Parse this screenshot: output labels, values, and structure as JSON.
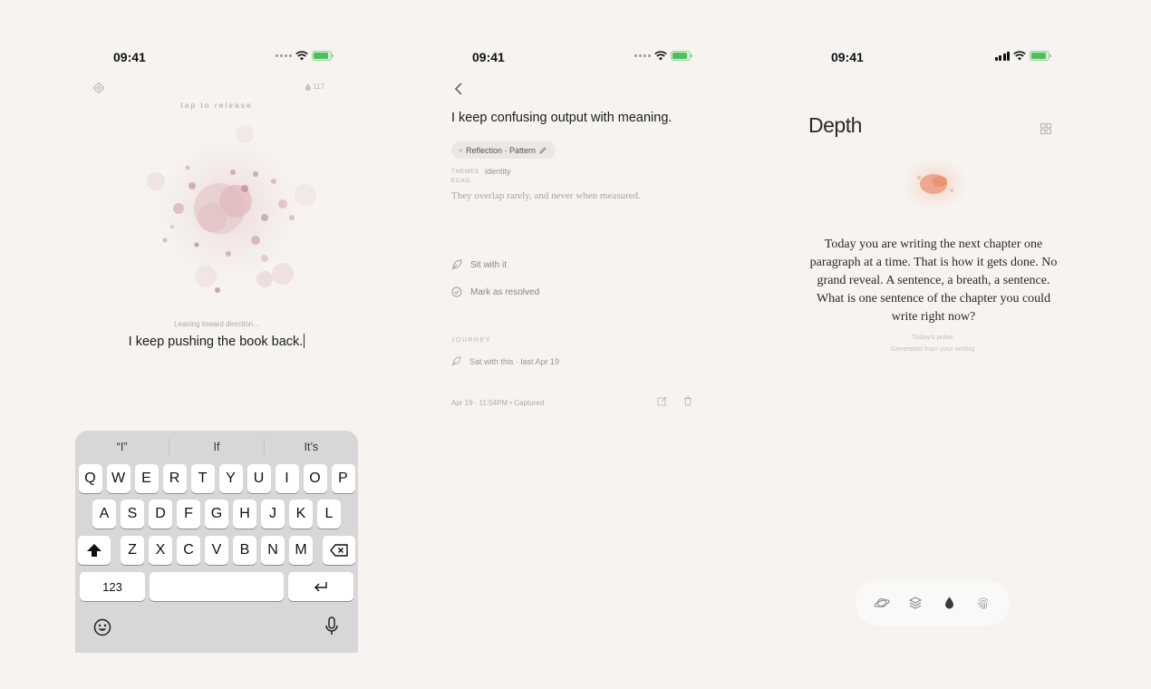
{
  "status_bar": {
    "time": "09:41"
  },
  "screen1": {
    "drop_count": "117",
    "tap_hint": "tap to release",
    "leaning_hint": "Leaning toward direction...",
    "typed_text": "I keep pushing the book back.",
    "keyboard": {
      "suggestions": [
        "“I”",
        "If",
        "It’s"
      ],
      "row1": [
        "Q",
        "W",
        "E",
        "R",
        "T",
        "Y",
        "U",
        "I",
        "O",
        "P"
      ],
      "row2": [
        "A",
        "S",
        "D",
        "F",
        "G",
        "H",
        "J",
        "K",
        "L"
      ],
      "row3": [
        "Z",
        "X",
        "C",
        "V",
        "B",
        "N",
        "M"
      ],
      "numbers_key": "123"
    }
  },
  "screen2": {
    "title": "I keep confusing output with meaning.",
    "chip_label": "Reflection · Pattern",
    "themes_label": "THEMES",
    "echo_label": "ECHO",
    "theme_value": "identity",
    "quote": "They overlap rarely, and never when measured.",
    "actions": [
      "Sit with it",
      "Mark as resolved"
    ],
    "journey_label": "JOURNEY",
    "journey_item": "Sat with this · last Apr 19",
    "footer": "Apr 19 · 11:54PM  •  Captured"
  },
  "screen3": {
    "title": "Depth",
    "paragraph": "Today you are writing the next chapter one paragraph at a time. That is how it gets done. No grand reveal. A sentence, a breath, a sentence. What is one sentence of the chapter you could write right now?",
    "pulse_label": "Today's pulse",
    "pulse_sub": "Generated from your writing",
    "tabs": [
      "planet-icon",
      "layers-icon",
      "drop-icon",
      "fingerprint-icon"
    ],
    "active_tab": "drop-icon"
  },
  "colors": {
    "background": "#f6f3f0",
    "keyboard": "#d7d7da",
    "accent_pink": "#d9a8b0",
    "accent_orange": "#e9967a",
    "battery_green": "#4cc15a"
  }
}
